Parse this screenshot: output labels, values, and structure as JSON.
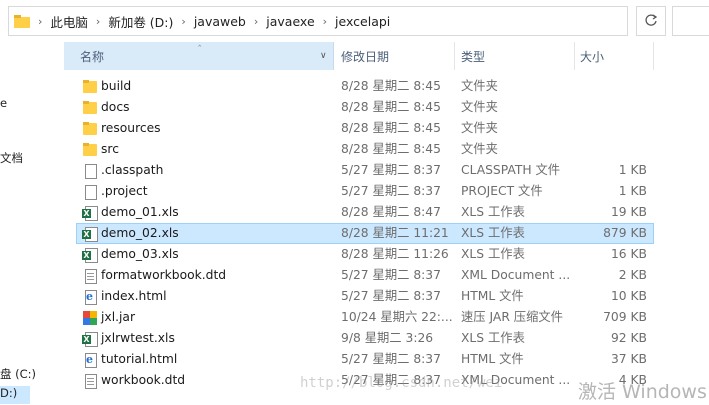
{
  "address": {
    "crumbs": [
      "此电脑",
      "新加卷 (D:)",
      "javaweb",
      "javaexe",
      "jexcelapi"
    ]
  },
  "nav": {
    "items": [
      {
        "label": "e"
      },
      {
        "label": "文档"
      },
      {
        "label": "盘 (C:)"
      },
      {
        "label": "D:)"
      }
    ]
  },
  "columns": {
    "name": "名称",
    "date": "修改日期",
    "type": "类型",
    "size": "大小"
  },
  "files": [
    {
      "icon": "folder-icon",
      "name": "build",
      "date": "8/28 星期二 8:45",
      "type": "文件夹",
      "size": ""
    },
    {
      "icon": "folder-icon",
      "name": "docs",
      "date": "8/28 星期二 8:45",
      "type": "文件夹",
      "size": ""
    },
    {
      "icon": "folder-icon",
      "name": "resources",
      "date": "8/28 星期二 8:45",
      "type": "文件夹",
      "size": ""
    },
    {
      "icon": "folder-icon",
      "name": "src",
      "date": "8/28 星期二 8:45",
      "type": "文件夹",
      "size": ""
    },
    {
      "icon": "file-icon",
      "name": ".classpath",
      "date": "5/27 星期二 8:37",
      "type": "CLASSPATH 文件",
      "size": "1 KB"
    },
    {
      "icon": "file-icon",
      "name": ".project",
      "date": "5/27 星期二 8:37",
      "type": "PROJECT 文件",
      "size": "1 KB"
    },
    {
      "icon": "xls-file-icon",
      "name": "demo_01.xls",
      "date": "8/28 星期二 8:47",
      "type": "XLS 工作表",
      "size": "19 KB"
    },
    {
      "icon": "xls-file-icon",
      "name": "demo_02.xls",
      "date": "8/28 星期二 11:21",
      "type": "XLS 工作表",
      "size": "879 KB"
    },
    {
      "icon": "xls-file-icon",
      "name": "demo_03.xls",
      "date": "8/28 星期二 11:26",
      "type": "XLS 工作表",
      "size": "16 KB"
    },
    {
      "icon": "dtd-file-icon",
      "name": "formatworkbook.dtd",
      "date": "5/27 星期二 8:37",
      "type": "XML Document ...",
      "size": "2 KB"
    },
    {
      "icon": "html-file-icon",
      "name": "index.html",
      "date": "5/27 星期二 8:37",
      "type": "HTML 文件",
      "size": "10 KB"
    },
    {
      "icon": "jar-file-icon",
      "name": "jxl.jar",
      "date": "10/24 星期六 22:...",
      "type": "速压 JAR 压缩文件",
      "size": "709 KB"
    },
    {
      "icon": "xls-file-icon",
      "name": "jxlrwtest.xls",
      "date": "9/8 星期二 3:26",
      "type": "XLS 工作表",
      "size": "92 KB"
    },
    {
      "icon": "html-file-icon",
      "name": "tutorial.html",
      "date": "5/27 星期二 8:37",
      "type": "HTML 文件",
      "size": "37 KB"
    },
    {
      "icon": "dtd-file-icon",
      "name": "workbook.dtd",
      "date": "5/27 星期二 8:37",
      "type": "XML Document ...",
      "size": "4 KB"
    }
  ],
  "selected_index": 7,
  "watermark": "http://blog.csdn.net/wei",
  "activation": "激活 Windows"
}
